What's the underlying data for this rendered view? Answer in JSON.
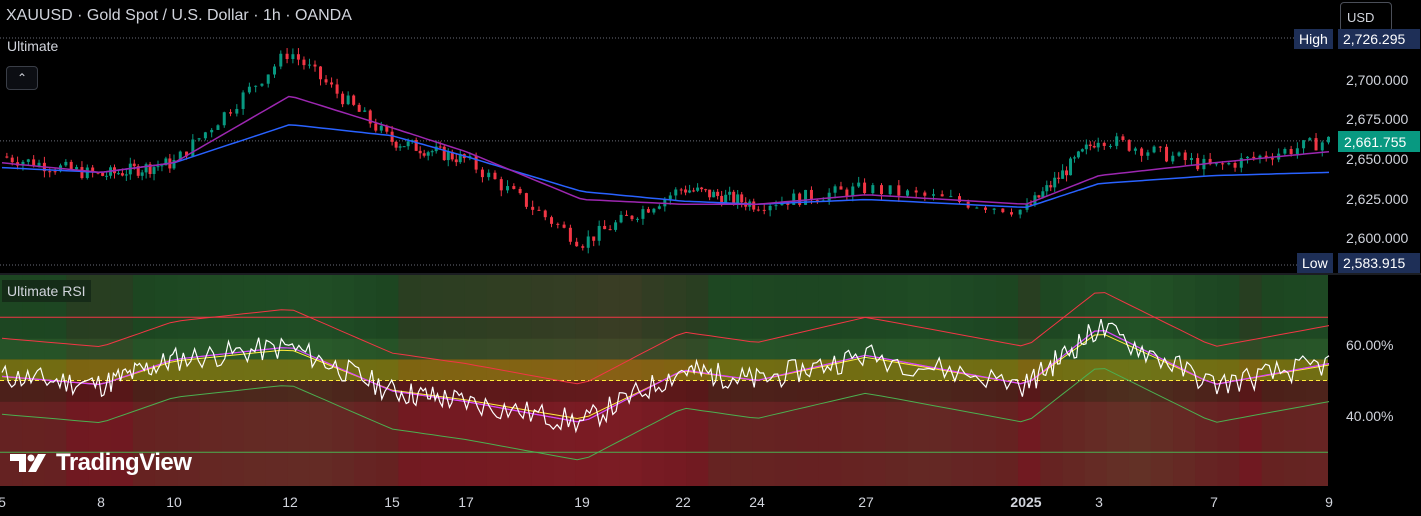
{
  "header": {
    "title": "XAUUSD · Gold Spot / U.S. Dollar · 1h · OANDA",
    "indicator_label": "Ultimate",
    "collapse_glyph": "⌃",
    "currency": "USD"
  },
  "rsi_panel": {
    "label": "Ultimate RSI"
  },
  "price_axis": {
    "labels": [
      "2,700.000",
      "2,675.000",
      "2,650.000",
      "2,625.000",
      "2,600.000"
    ],
    "high_tag": "High",
    "high_value": "2,726.295",
    "low_tag": "Low",
    "low_value": "2,583.915",
    "last_price": "2,661.755"
  },
  "rsi_axis": {
    "labels": [
      "60.00%",
      "40.00%"
    ]
  },
  "x_axis": {
    "labels": [
      "5",
      "8",
      "10",
      "12",
      "15",
      "17",
      "19",
      "22",
      "24",
      "27",
      "2025",
      "3",
      "7",
      "9"
    ]
  },
  "logo": {
    "text": "TradingView"
  },
  "colors": {
    "bull": "#089981",
    "bear": "#f23645",
    "ma_slow": "#2962ff",
    "ma_fast": "#9c27b0",
    "rsi": "#ffffff",
    "rsi_upper": "#f23645",
    "rsi_lower": "#4caf50",
    "signal_magenta": "#e040fb",
    "signal_yellow": "#ffeb3b",
    "signal_cyan": "#26c6da"
  },
  "chart_data": [
    {
      "type": "candlestick",
      "symbol": "XAUUSD",
      "interval": "1h",
      "ylim": [
        2583.915,
        2726.295
      ],
      "high": 2726.295,
      "low": 2583.915,
      "last": 2661.755,
      "x": [
        "5",
        "8",
        "10",
        "12",
        "15",
        "17",
        "19",
        "22",
        "24",
        "27",
        "2025",
        "3",
        "7",
        "9"
      ],
      "close": [
        2652,
        2640,
        2648,
        2718,
        2662,
        2650,
        2598,
        2632,
        2622,
        2632,
        2618,
        2664,
        2645,
        2662
      ],
      "ma_fast": [
        2648,
        2642,
        2648,
        2690,
        2670,
        2655,
        2625,
        2622,
        2622,
        2628,
        2622,
        2640,
        2648,
        2655
      ],
      "ma_slow": [
        2645,
        2642,
        2648,
        2672,
        2665,
        2652,
        2630,
        2624,
        2622,
        2625,
        2620,
        2635,
        2640,
        2642
      ]
    },
    {
      "type": "line",
      "title": "Ultimate RSI",
      "ylim": [
        0,
        100
      ],
      "x": [
        "5",
        "8",
        "10",
        "12",
        "15",
        "17",
        "19",
        "22",
        "24",
        "27",
        "2025",
        "3",
        "7",
        "9"
      ],
      "series": [
        {
          "values": [
            52,
            48,
            60,
            66,
            45,
            40,
            30,
            55,
            50,
            62,
            48,
            75,
            48,
            58
          ]
        }
      ],
      "levels": [
        50
      ]
    }
  ]
}
